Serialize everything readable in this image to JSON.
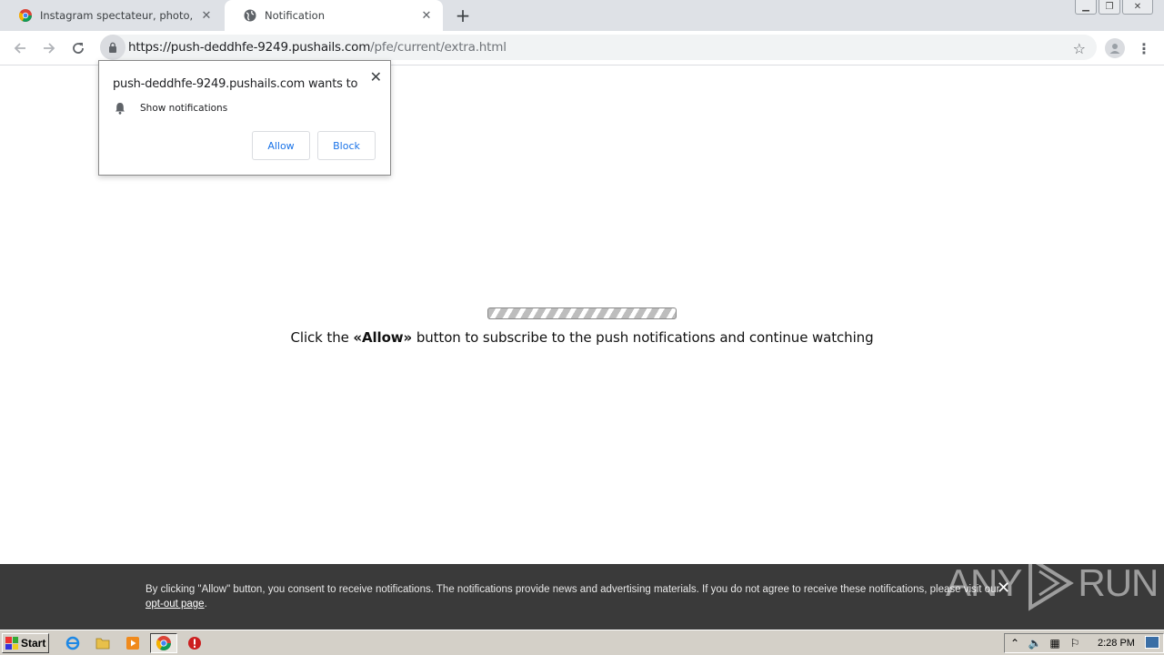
{
  "browser": {
    "tabs": [
      {
        "title": "Instagram spectateur, photo, vidéo",
        "active": false
      },
      {
        "title": "Notification",
        "active": true
      }
    ],
    "new_tab_symbol": "+",
    "url_host": "https://push-deddhfe-9249.pushails.com",
    "url_path": "/pfe/current/extra.html"
  },
  "popup": {
    "title": "push-deddhfe-9249.pushails.com wants to",
    "permission": "Show notifications",
    "allow_label": "Allow",
    "block_label": "Block"
  },
  "page": {
    "instruction_before": "Click the ",
    "instruction_bold": "«Allow»",
    "instruction_after": " button to subscribe to the push notifications and continue watching"
  },
  "consent": {
    "text": "By clicking \"Allow\" button, you consent to receive notifications. The notifications provide news and advertising materials. If you do not agree to receive these notifications, please visit our ",
    "link": "opt-out page",
    "end": "."
  },
  "watermark": "ANY RUN",
  "taskbar": {
    "start_label": "Start",
    "clock": "2:28 PM"
  },
  "colors": {
    "accent_blue": "#1a73e8",
    "consent_bg": "#3a3a3a",
    "tabstrip_bg": "#dee1e6"
  }
}
